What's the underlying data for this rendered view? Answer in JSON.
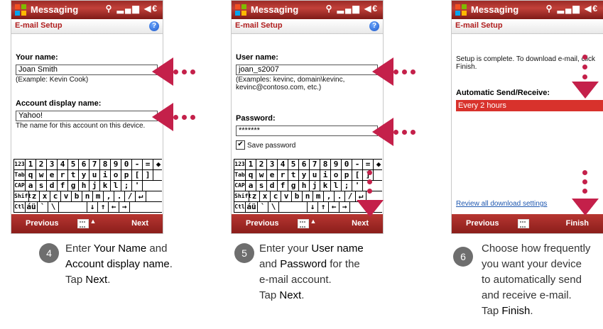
{
  "colors": {
    "accent": "#c4204a",
    "titlebar": "#b0302b",
    "link": "#1f58b0"
  },
  "titlebar": {
    "title": "Messaging",
    "status_icons": "⚲ ▂▄▆ ◀€"
  },
  "subtitle": "E-mail Setup",
  "help_label": "?",
  "keyboard": {
    "rows": [
      [
        "123",
        "1",
        "2",
        "3",
        "4",
        "5",
        "6",
        "7",
        "8",
        "9",
        "0",
        "-",
        "=",
        "◆"
      ],
      [
        "Tab",
        "q",
        "w",
        "e",
        "r",
        "t",
        "y",
        "u",
        "i",
        "o",
        "p",
        "[",
        "]"
      ],
      [
        "CAP",
        "a",
        "s",
        "d",
        "f",
        "g",
        "h",
        "j",
        "k",
        "l",
        ";",
        "'"
      ],
      [
        "Shift",
        "z",
        "x",
        "c",
        "v",
        "b",
        "n",
        "m",
        ",",
        ".",
        "/",
        "↵"
      ],
      [
        "Ctl",
        "áü",
        "`",
        "\\",
        "",
        "↓",
        "↑",
        "←",
        "→"
      ]
    ]
  },
  "screen1": {
    "name_label": "Your name:",
    "name_value": "Joan Smith",
    "name_example": "(Example: Kevin Cook)",
    "display_label": "Account display name:",
    "display_value": "Yahoo!",
    "display_note": "The name for this account on this device.",
    "left_btn": "Previous",
    "right_btn": "Next"
  },
  "screen2": {
    "user_label": "User name:",
    "user_value": "joan_s2007",
    "user_example": "(Examples: kevinc, domain\\kevinc, kevinc@contoso.com, etc.)",
    "pw_label": "Password:",
    "pw_value": "*******",
    "save_label": "Save password",
    "save_mark": "✔",
    "left_btn": "Previous",
    "right_btn": "Next"
  },
  "screen3": {
    "complete_text": "Setup is complete.  To download e-mail, click Finish.",
    "auto_label": "Automatic Send/Receive:",
    "auto_value": "Every 2 hours",
    "review_link": "Review all download settings",
    "left_btn": "Previous",
    "right_btn": "Finish"
  },
  "steps": [
    {
      "num": "4",
      "l1a": "Enter ",
      "l1b": "Your Name",
      "l1c": " and",
      "l2": "Account display name",
      "l2c": ".",
      "l3a": "Tap ",
      "l3b": "Next",
      "l3c": "."
    },
    {
      "num": "5",
      "l1a": "Enter your ",
      "l1b": "User name",
      "l2a": "and ",
      "l2b": "Password",
      "l2c": " for the",
      "l3": "e-mail account.",
      "l4a": "Tap ",
      "l4b": "Next",
      "l4c": "."
    },
    {
      "num": "6",
      "l1": "Choose how frequently",
      "l2": "you want your device",
      "l3": "to automatically send",
      "l4": "and receive e-mail.",
      "l5a": "Tap ",
      "l5b": "Finish",
      "l5c": "."
    }
  ]
}
